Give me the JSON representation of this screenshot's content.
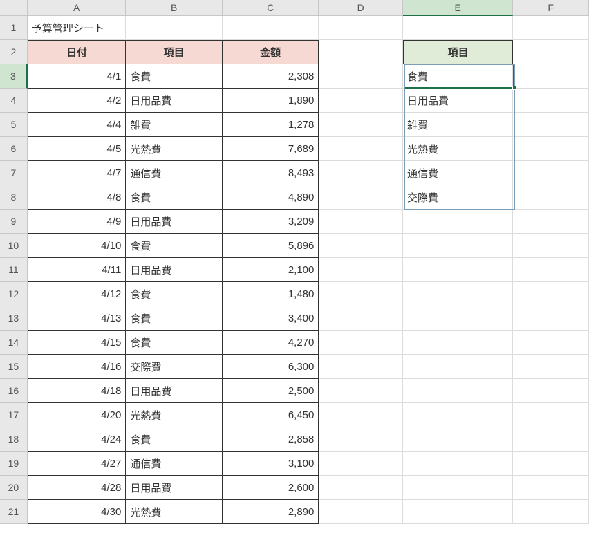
{
  "columns": [
    "A",
    "B",
    "C",
    "D",
    "E",
    "F"
  ],
  "title": "予算管理シート",
  "table_headers": {
    "date": "日付",
    "item": "項目",
    "amount": "金額"
  },
  "data_rows": [
    {
      "date": "4/1",
      "item": "食費",
      "amount": "2,308"
    },
    {
      "date": "4/2",
      "item": "日用品費",
      "amount": "1,890"
    },
    {
      "date": "4/4",
      "item": "雑費",
      "amount": "1,278"
    },
    {
      "date": "4/5",
      "item": "光熱費",
      "amount": "7,689"
    },
    {
      "date": "4/7",
      "item": "通信費",
      "amount": "8,493"
    },
    {
      "date": "4/8",
      "item": "食費",
      "amount": "4,890"
    },
    {
      "date": "4/9",
      "item": "日用品費",
      "amount": "3,209"
    },
    {
      "date": "4/10",
      "item": "食費",
      "amount": "5,896"
    },
    {
      "date": "4/11",
      "item": "日用品費",
      "amount": "2,100"
    },
    {
      "date": "4/12",
      "item": "食費",
      "amount": "1,480"
    },
    {
      "date": "4/13",
      "item": "食費",
      "amount": "3,400"
    },
    {
      "date": "4/15",
      "item": "食費",
      "amount": "4,270"
    },
    {
      "date": "4/16",
      "item": "交際費",
      "amount": "6,300"
    },
    {
      "date": "4/18",
      "item": "日用品費",
      "amount": "2,500"
    },
    {
      "date": "4/20",
      "item": "光熱費",
      "amount": "6,450"
    },
    {
      "date": "4/24",
      "item": "食費",
      "amount": "2,858"
    },
    {
      "date": "4/27",
      "item": "通信費",
      "amount": "3,100"
    },
    {
      "date": "4/28",
      "item": "日用品費",
      "amount": "2,600"
    },
    {
      "date": "4/30",
      "item": "光熱費",
      "amount": "2,890"
    }
  ],
  "side_header": "項目",
  "side_list": [
    "食費",
    "日用品費",
    "雑費",
    "光熱費",
    "通信費",
    "交際費"
  ],
  "active_cell": "E3",
  "row_count": 21
}
